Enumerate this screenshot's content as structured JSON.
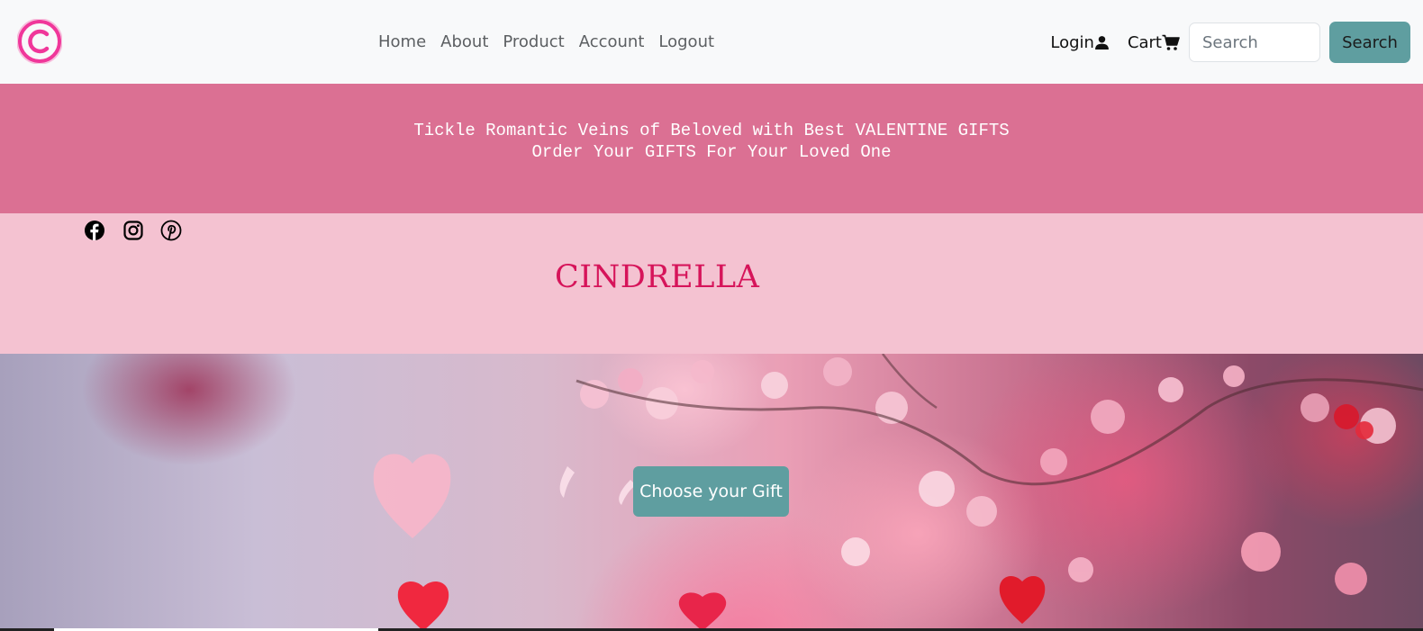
{
  "navbar": {
    "links": [
      "Home",
      "About",
      "Product",
      "Account",
      "Logout"
    ],
    "login_label": "Login",
    "cart_label": "Cart",
    "search": {
      "placeholder": "Search",
      "value": ""
    },
    "search_button": "Search",
    "icons": {
      "logo": "copyright-logo-icon",
      "login": "user-icon",
      "cart": "cart-icon"
    }
  },
  "promo": {
    "line1": "Tickle Romantic Veins of Beloved with Best VALENTINE GIFTS",
    "line2": "Order Your GIFTS For Your Loved One"
  },
  "brand": {
    "title": "CINDRELLA",
    "social_icons": [
      "facebook-icon",
      "instagram-icon",
      "pinterest-icon"
    ]
  },
  "hero": {
    "cta_label": "Choose your Gift"
  },
  "colors": {
    "navbar_bg": "#f8f9fa",
    "promo_bg": "#db7093",
    "brand_bg": "#f4c2d1",
    "brand_title": "#d6145a",
    "button_bg": "#5f9ea0",
    "logo": "#f0379a"
  }
}
